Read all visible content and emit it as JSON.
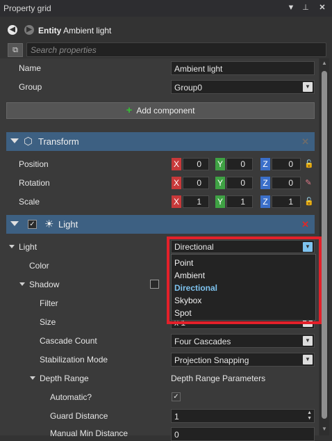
{
  "window": {
    "title": "Property grid"
  },
  "nav": {
    "entity_label": "Entity",
    "entity_name": "Ambient light"
  },
  "search": {
    "placeholder": "Search properties"
  },
  "fields": {
    "name_label": "Name",
    "name_value": "Ambient light",
    "group_label": "Group",
    "group_value": "Group0"
  },
  "add_component_label": "Add component",
  "transform": {
    "title": "Transform",
    "position_label": "Position",
    "rotation_label": "Rotation",
    "scale_label": "Scale",
    "position": {
      "x": "0",
      "y": "0",
      "z": "0"
    },
    "rotation": {
      "x": "0",
      "y": "0",
      "z": "0"
    },
    "scale": {
      "x": "1",
      "y": "1",
      "z": "1"
    },
    "axis_labels": {
      "x": "X",
      "y": "Y",
      "z": "Z"
    }
  },
  "light_section": {
    "title": "Light"
  },
  "light": {
    "label": "Light",
    "type_value": "Directional",
    "color_label": "Color",
    "shadow_label": "Shadow",
    "filter_label": "Filter",
    "size_label": "Size",
    "size_value": "x 1",
    "cascade_label": "Cascade Count",
    "cascade_value": "Four Cascades",
    "stab_label": "Stabilization Mode",
    "stab_value": "Projection Snapping",
    "depth_label": "Depth Range",
    "depth_value": "Depth Range Parameters",
    "auto_label": "Automatic?",
    "guard_label": "Guard Distance",
    "guard_value": "1",
    "manual_min_label": "Manual Min Distance",
    "manual_min_value": "0"
  },
  "dropdown": {
    "options": [
      "Point",
      "Ambient",
      "Directional",
      "Skybox",
      "Spot"
    ],
    "selected": "Directional"
  },
  "colors": {
    "section": "#3d6082",
    "highlight": "#e3202a",
    "x_axis": "#c8393a",
    "y_axis": "#3fa244",
    "z_axis": "#3b6fc9"
  }
}
